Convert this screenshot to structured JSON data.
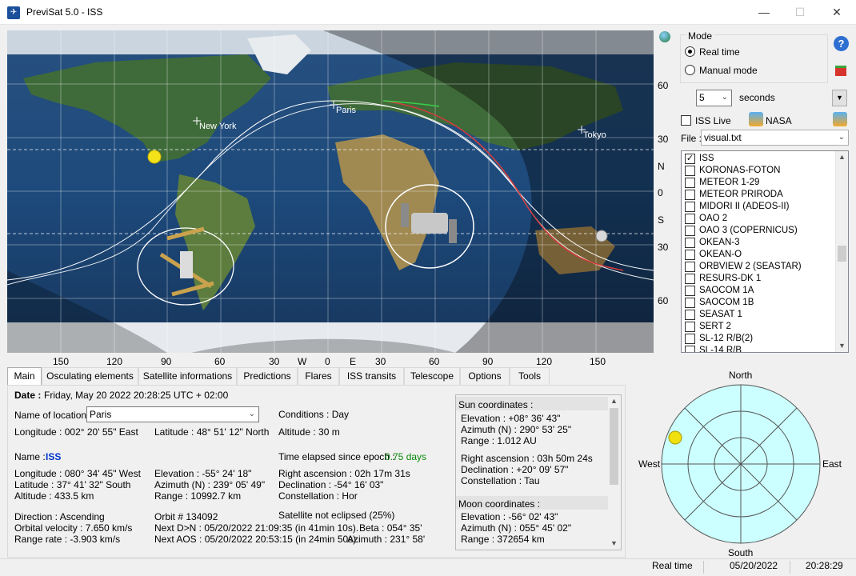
{
  "window": {
    "title": "PreviSat 5.0 - ISS",
    "min": "—",
    "max": "☐",
    "close": "✕"
  },
  "map": {
    "cities": [
      "New York",
      "Paris",
      "Tokyo"
    ],
    "lat_labels": [
      "60",
      "30",
      "N",
      "0",
      "S",
      "30",
      "60"
    ],
    "lon_labels": [
      "150",
      "120",
      "90",
      "60",
      "30",
      "W",
      "0",
      "E",
      "30",
      "60",
      "90",
      "120",
      "150"
    ]
  },
  "mode": {
    "group_label": "Mode",
    "real_time": "Real time",
    "manual": "Manual mode",
    "interval_value": "5",
    "interval_unit": "seconds"
  },
  "iss_live": {
    "label": "ISS Live",
    "nasa": "NASA"
  },
  "file": {
    "label": "File :",
    "value": "visual.txt"
  },
  "satellites": [
    {
      "name": "ISS",
      "checked": true
    },
    {
      "name": "KORONAS-FOTON",
      "checked": false
    },
    {
      "name": "METEOR 1-29",
      "checked": false
    },
    {
      "name": "METEOR PRIRODA",
      "checked": false
    },
    {
      "name": "MIDORI II (ADEOS-II)",
      "checked": false
    },
    {
      "name": "OAO 2",
      "checked": false
    },
    {
      "name": "OAO 3 (COPERNICUS)",
      "checked": false
    },
    {
      "name": "OKEAN-3",
      "checked": false
    },
    {
      "name": "OKEAN-O",
      "checked": false
    },
    {
      "name": "ORBVIEW 2 (SEASTAR)",
      "checked": false
    },
    {
      "name": "RESURS-DK 1",
      "checked": false
    },
    {
      "name": "SAOCOM 1A",
      "checked": false
    },
    {
      "name": "SAOCOM 1B",
      "checked": false
    },
    {
      "name": "SEASAT 1",
      "checked": false
    },
    {
      "name": "SERT 2",
      "checked": false
    },
    {
      "name": "SL-12 R/B(2)",
      "checked": false
    },
    {
      "name": "SL-14 R/B",
      "checked": false
    }
  ],
  "tabs": [
    "Main",
    "Osculating elements",
    "Satellite informations",
    "Predictions",
    "Flares",
    "ISS transits",
    "Telescope",
    "Options",
    "Tools"
  ],
  "main": {
    "date_label": "Date :",
    "date_value": "Friday, May 20 2022  20:28:25  UTC + 02:00",
    "location_label": "Name of location :",
    "location_value": "Paris",
    "conditions": "Conditions : Day",
    "obs_longitude": "Longitude :  002° 20' 55\" East",
    "obs_latitude": "Latitude :  48° 51' 12\" North",
    "obs_altitude": "Altitude :  30 m",
    "name_label": "Name :",
    "name_value": "ISS",
    "elapsed_label": "Time elapsed since epoch :",
    "elapsed_value": "0.75 days",
    "sat_longitude": "Longitude :  080° 34' 45\" West",
    "sat_latitude": "Latitude :      37° 41' 32\" South",
    "sat_altitude": "Altitude :          433.5 km",
    "elevation": "Elevation :         -55° 24' 18\"",
    "azimuth": "Azimuth (N) :   239° 05' 49\"",
    "range": "Range :              10992.7 km",
    "right_ascension": "Right ascension :  02h 17m 31s",
    "declination": "Declination :          -54° 16' 03\"",
    "constellation": "Constellation :         Hor",
    "direction": "Direction :              Ascending",
    "orbital_velocity": "Orbital velocity :  7.650 km/s",
    "range_rate": "Range rate :       -3.903 km/s",
    "orbit": "Orbit # 134092",
    "next_dn": "Next D>N : 05/20/2022 21:09:35  (in 41min 10s).",
    "next_aos": "Next AOS : 05/20/2022 20:53:15  (in 24min 50s).",
    "eclipse": "Satellite not eclipsed (25%)",
    "beta": "Beta :  054° 35'",
    "aos_azimuth": "Azimuth :  231° 58'"
  },
  "sun": {
    "header": "Sun coordinates :",
    "elevation": "Elevation :       +08° 36' 43\"",
    "azimuth": "Azimuth (N) :  290° 53' 25\"",
    "range": "Range :              1.012 AU",
    "right_ascension": "Right ascension :   03h 50m 24s",
    "declination": "Declination :          +20° 09' 57\"",
    "constellation": "Constellation :        Tau"
  },
  "moon": {
    "header": "Moon coordinates :",
    "elevation": "Elevation :         -56° 02' 43\"",
    "azimuth": "Azimuth (N) :   055° 45' 02\"",
    "range": "Range :              372654 km"
  },
  "sky": {
    "north": "North",
    "south": "South",
    "east": "East",
    "west": "West"
  },
  "status": {
    "mode": "Real time",
    "date": "05/20/2022",
    "time": "20:28:29"
  }
}
